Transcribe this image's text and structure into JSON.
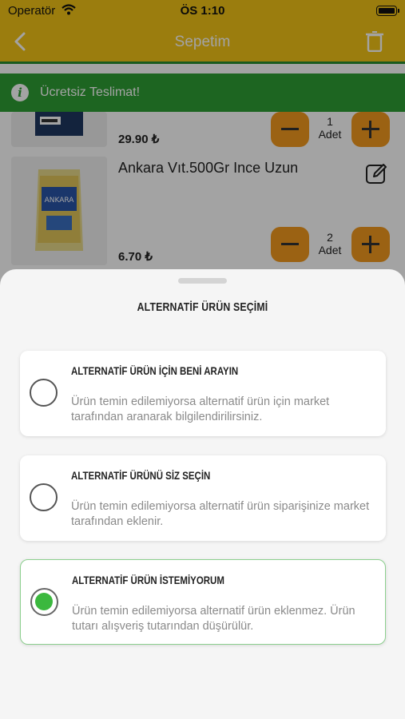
{
  "status_bar": {
    "carrier": "Operatör",
    "time": "ÖS 1:10"
  },
  "nav": {
    "title": "Sepetim"
  },
  "banner": {
    "text": "Ücretsiz Teslimat!"
  },
  "cart_items": [
    {
      "name": "",
      "price": "29.90 ₺",
      "quantity": "1",
      "unit": "Adet"
    },
    {
      "name": "Ankara Vıt.500Gr Ince Uzun",
      "price": "6.70 ₺",
      "quantity": "2",
      "unit": "Adet"
    }
  ],
  "colors": {
    "nav_yellow": "#f2c417",
    "banner_green": "#2e9e35",
    "qty_orange": "#f29a1f",
    "radio_green": "#3bb83e"
  },
  "sheet": {
    "title": "ALTERNATİF ÜRÜN SEÇİMİ",
    "options": [
      {
        "title": "ALTERNATİF ÜRÜN İÇİN BENİ ARAYIN",
        "description": "Ürün temin edilemiyorsa alternatif ürün için market tarafından aranarak bilgilendirilirsiniz.",
        "selected": false
      },
      {
        "title": "ALTERNATİF ÜRÜNÜ SİZ SEÇİN",
        "description": "Ürün temin edilemiyorsa alternatif ürün siparişinize market tarafından eklenir.",
        "selected": false
      },
      {
        "title": "ALTERNATİF ÜRÜN İSTEMİYORUM",
        "description": "Ürün temin edilemiyorsa alternatif ürün eklenmez. Ürün tutarı alışveriş tutarından düşürülür.",
        "selected": true
      }
    ]
  }
}
